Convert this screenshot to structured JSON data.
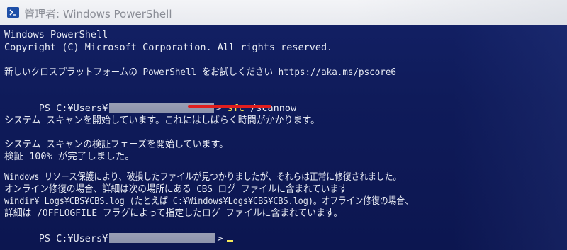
{
  "window": {
    "title": "管理者: Windows PowerShell"
  },
  "icons": {
    "app": "powershell-icon"
  },
  "colors": {
    "console_bg": "#102060",
    "console_text": "#e9ecf4",
    "command_text": "#f5e85a",
    "underline": "#e01e1e"
  },
  "console": {
    "lines": [
      "Windows PowerShell",
      "Copyright (C) Microsoft Corporation. All rights reserved.",
      "新しいクロスプラットフォームの PowerShell をお試しください https://aka.ms/pscore6",
      "PS C:¥Users¥",
      "システム スキャンを開始しています。これにはしばらく時間がかかります。",
      "システム スキャンの検証フェーズを開始しています。",
      "検証 100% が完了しました。",
      "Windows リソース保護により、破損したファイルが見つかりましたが、それらは正常に修復されました。",
      "オンライン修復の場合、詳細は次の場所にある CBS ログ ファイルに含まれています",
      "windir¥ Logs¥CBS¥CBS.log (たとえば C:¥Windows¥Logs¥CBS¥CBS.log)。オフライン修復の場合、",
      "詳細は /OFFLOGFILE フラグによって指定したログ ファイルに含まれています。",
      "PS C:¥Users¥"
    ],
    "prompt_suffix": ">",
    "command_name": "sfc",
    "command_args": "/scannow"
  }
}
